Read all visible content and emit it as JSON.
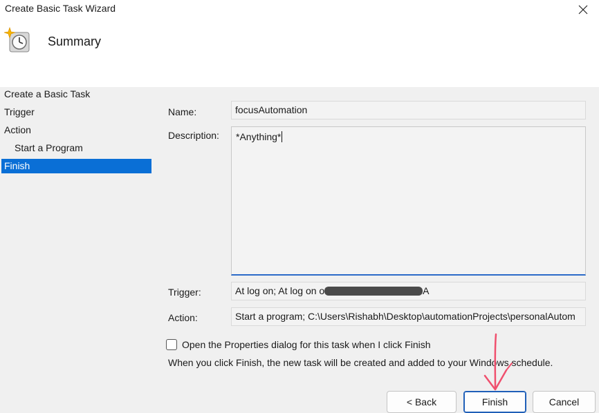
{
  "window": {
    "title": "Create Basic Task Wizard"
  },
  "header": {
    "title": "Summary",
    "icon": "task-scheduler-icon"
  },
  "nav": {
    "items": [
      {
        "label": "Create a Basic Task"
      },
      {
        "label": "Trigger"
      },
      {
        "label": "Action"
      },
      {
        "label": "Start a Program"
      },
      {
        "label": "Finish"
      }
    ],
    "active": "Finish"
  },
  "form": {
    "name_label": "Name:",
    "name_value": "focusAutomation",
    "description_label": "Description:",
    "description_value": "*Anything*",
    "trigger_label": "Trigger:",
    "trigger_value": "At log on; At log on of",
    "trigger_value_tail": "A",
    "action_label": "Action:",
    "action_value": "Start a program; C:\\Users\\Rishabh\\Desktop\\automationProjects\\personalAutom"
  },
  "options": {
    "open_properties_label": "Open the Properties dialog for this task when I click Finish",
    "open_properties_checked": false,
    "info_text": "When you click Finish, the new task will be created and added to your Windows schedule."
  },
  "buttons": {
    "back": "< Back",
    "finish": "Finish",
    "cancel": "Cancel"
  },
  "colors": {
    "selection": "#0a6fd6",
    "annotation": "#f0506e"
  }
}
